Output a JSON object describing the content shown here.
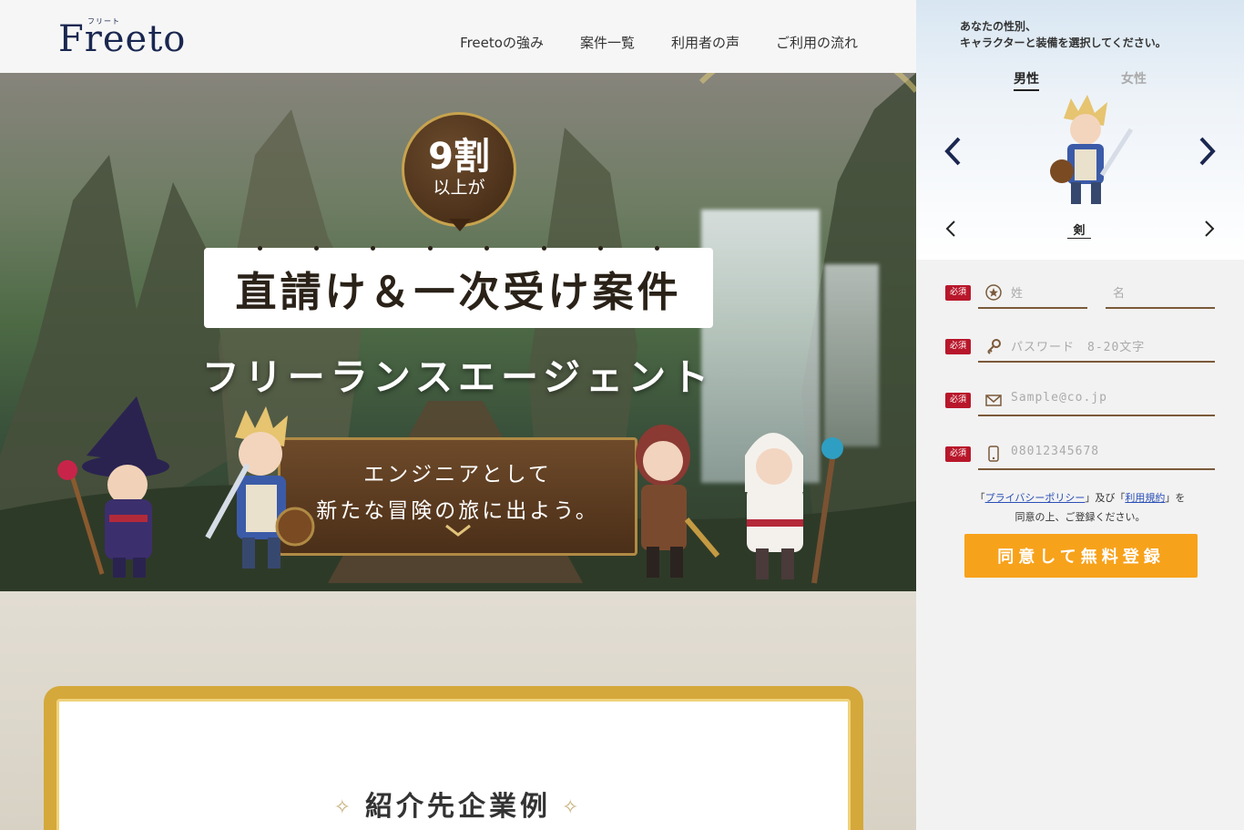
{
  "header": {
    "logo_sup": "フリート",
    "logo_text": "Freeto",
    "nav": [
      "Freetoの強み",
      "案件一覧",
      "利用者の声",
      "ご利用の流れ"
    ]
  },
  "hero": {
    "badge_big": "9割",
    "badge_small": "以上が",
    "headline": "直請け＆一次受け案件",
    "subheadline": "フリーランスエージェント",
    "board_line1": "エンジニアとして",
    "board_line2": "新たな冒険の旅に出よう。"
  },
  "section": {
    "title": "紹介先企業例"
  },
  "panel": {
    "instruction_line1": "あなたの性別、",
    "instruction_line2": "キャラクターと装備を選択してください。",
    "gender_male": "男性",
    "gender_female": "女性",
    "weapon": "剣",
    "required_label": "必須",
    "field_last_name": "姓",
    "field_first_name": "名",
    "field_password": "パスワード　8-20文字",
    "field_email": "Sample@co.jp",
    "field_phone": "08012345678",
    "policy_open1": "「",
    "policy_link_privacy": "プライバシーポリシー",
    "policy_mid": "」及び「",
    "policy_link_terms": "利用規約",
    "policy_close": "」を",
    "policy_line2": "同意の上、ご登録ください。",
    "submit": "同意して無料登録"
  },
  "colors": {
    "brand_navy": "#1a2750",
    "cta_orange": "#f7a21b",
    "required_red": "#b8172b",
    "gold": "#d4a83a"
  }
}
